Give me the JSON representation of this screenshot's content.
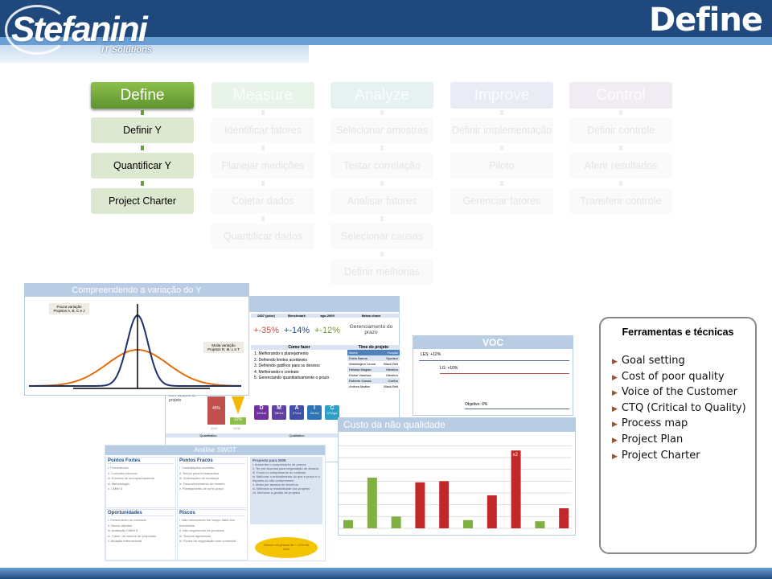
{
  "header": {
    "title": "Define",
    "logo_text": "Stefanini",
    "logo_sub": "IT Solutions"
  },
  "phases": [
    {
      "name": "Define",
      "color": "#6aa040",
      "active": true,
      "steps": [
        "Definir Y",
        "Quantificar Y",
        "Project Charter"
      ]
    },
    {
      "name": "Measure",
      "color": "#e8f3ea",
      "active": false,
      "steps": [
        "Identificar fatores",
        "Planejar medições",
        "Coletar dados",
        "Quantificar dados"
      ]
    },
    {
      "name": "Analyze",
      "color": "#e6f2f2",
      "active": false,
      "steps": [
        "Selecionar amostras",
        "Testar correlação",
        "Analisar fatores",
        "Selecionar causas",
        "Definir melhorias"
      ]
    },
    {
      "name": "Improve",
      "color": "#e9ebf5",
      "active": false,
      "steps": [
        "Definir implementação",
        "Piloto",
        "Gerenciar fatores"
      ]
    },
    {
      "name": "Control",
      "color": "#f1ecf3",
      "active": false,
      "steps": [
        "Definir controle",
        "Aferir resultados",
        "Transferir controle"
      ]
    }
  ],
  "variation": {
    "title": "Compreendendo a variação do Y",
    "label_low": "Pouca variação Projetos A, B, C e J",
    "label_high": "Muita variação Projetos R, M, L e T",
    "delay_text": "com atrasos de projeto",
    "bar1": "45%",
    "bar2": "12%",
    "year1": "2007",
    "year2": "2008"
  },
  "charter": {
    "title": "Project Charter",
    "headers": [
      "2007 (prior)",
      "Benchmark",
      "ago-2009",
      "Metas chave"
    ],
    "values": [
      "+-35%",
      "+-14%",
      "+-12%"
    ],
    "goal": "Gerenciamento do prazo",
    "how_title": "Como fazer",
    "how": [
      "1. Melhorando o planejamento",
      "2. Definindo limites aceitáveis",
      "3. Definindo gatilhos para os desvios",
      "4. Melhorando o contrato",
      "5. Gerenciando quantitativamente o prazo"
    ],
    "team_title": "Time do projeto",
    "team_headers": [
      "Nome",
      "Função"
    ],
    "team": [
      [
        "Edcio Barros",
        "Sponsor"
      ],
      [
        "Washington Leone",
        "Black Belt"
      ],
      [
        "Heloisa Magalo",
        "Membro"
      ],
      [
        "Elaine Vanessa",
        "Membro"
      ],
      [
        "Roberto Garota",
        "Coelho"
      ],
      [
        "Andrea Mattos",
        "Black Belt"
      ]
    ],
    "dmaic": [
      [
        "D",
        "12/Jun"
      ],
      [
        "M",
        "08/Jul"
      ],
      [
        "A",
        "17/Jul"
      ],
      [
        "I",
        "24/Jul"
      ],
      [
        "C",
        "07/Ago"
      ]
    ],
    "bottom_headers": [
      "Quantitativo",
      "Qualitativo",
      "Pontos de atenção"
    ],
    "attention": [
      "1. Prazo curto",
      "2. Disponibilidade",
      "3. Demanda alta"
    ]
  },
  "swot": {
    "title": "Análise SWOT",
    "strengths_title": "Pontos Fortes",
    "strengths": [
      "i. Ferramentas",
      "ii. Controles internos",
      "iii. Eventos de acompanhamento",
      "iv. Metodologia",
      "v. CMMI 5"
    ],
    "weaknesses_title": "Pontos Fracos",
    "weaknesses": [
      "i. Contratações recentes",
      "ii. Tempo para treinamentos",
      "iii. Solicitações de mudança",
      "iv. Desconhecimento do modelo",
      "v. Planejamento de curto prazo"
    ],
    "opportunities_title": "Oportunidades",
    "opportunities": [
      "i. Crescimento do mercado",
      "ii. Novos clientes",
      "iii. Avaliação CMMI 5",
      "iv. Cresc. do volume de propostas",
      "v. Atuação internacional"
    ],
    "risks_title": "Riscos",
    "risks": [
      "i. Não treinamento em tempo hábil dos envolvidos",
      "ii. Não seguimento do processo",
      "iii. Tempos agressivos",
      "iv. Forma de negociação com comercial"
    ],
    "proposal_title": "Proposta para 2008",
    "proposal": [
      "i. Aumentar o cumprimento de prazos",
      "ii. Ter pré-acordos para negociação de atrasos",
      "iii. Focar no cumprimento do contrato",
      "iv. Melhorar o entendimento do que é prazo e o impacto do não cumprimento",
      "v. Multa por atrasos de terceiros",
      "vi. Melhorar a rentabilidade dos projetos",
      "vii. Melhorar a gestão de projetos"
    ],
    "burst": "Desvio em prazos de +-12% do todo"
  },
  "voc": {
    "title": "VOC",
    "les": "LES: +12%",
    "lg": "LG: +10%",
    "objective": "Objetivo: 0%"
  },
  "coq": {
    "title": "Custo da não qualidade",
    "marker": "x2",
    "chart_data": {
      "type": "bar",
      "values": [
        0.7,
        4.3,
        1,
        3.9,
        4,
        0.7,
        2.8,
        6.6,
        0.6,
        1.7
      ],
      "colors": [
        "green",
        "green",
        "green",
        "red",
        "red",
        "green",
        "red",
        "red",
        "green",
        "red"
      ],
      "ylim": [
        0,
        7.5
      ],
      "grid": true,
      "annotation": "x2"
    }
  },
  "tools": {
    "title": "Ferramentas e técnicas",
    "items": [
      "Goal setting",
      "Cost of poor quality",
      "Voice of the Customer",
      "CTQ (Critical to Quality)",
      "Process map",
      "Project Plan",
      "Project Charter"
    ]
  }
}
